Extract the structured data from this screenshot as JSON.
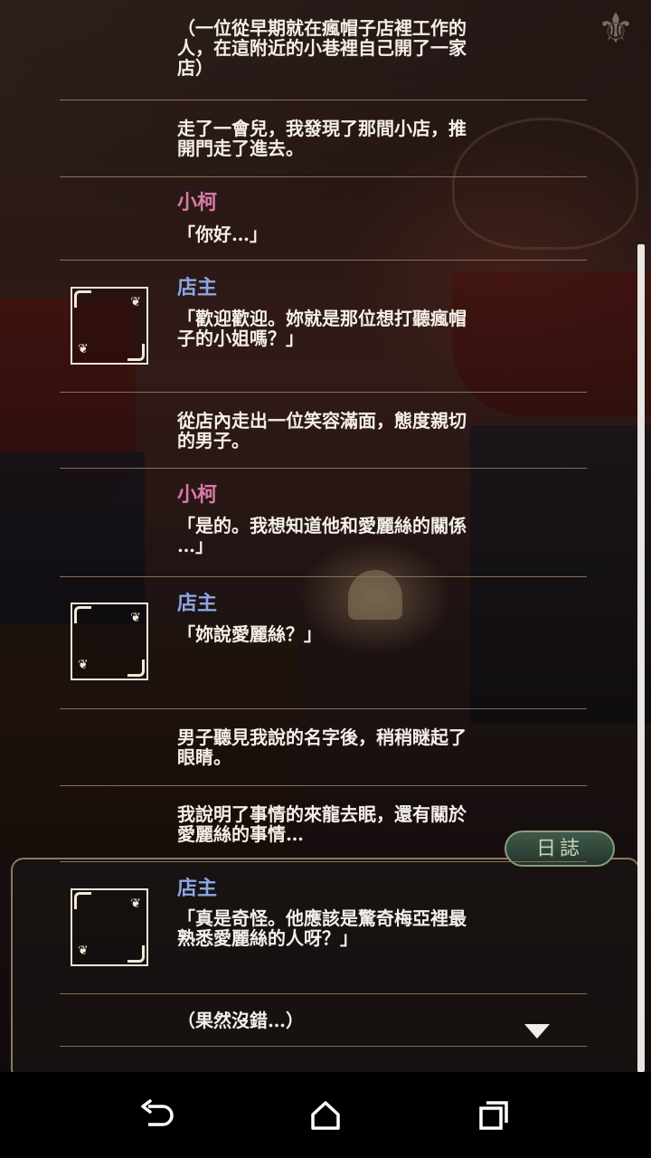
{
  "log_button_label": "日誌",
  "entries": [
    {
      "speaker": "",
      "text": "（一位從早期就在瘋帽子店裡工作的\n人，在這附近的小巷裡自己開了一家\n店）"
    },
    {
      "speaker": "",
      "text": "走了一會兒，我發現了那間小店，推\n開門走了進去。"
    },
    {
      "speaker": "小柯",
      "text": "「你好…」"
    },
    {
      "speaker": "店主",
      "text": "「歡迎歡迎。妳就是那位想打聽瘋帽\n子的小姐嗎？」"
    },
    {
      "speaker": "",
      "text": "從店內走出一位笑容滿面，態度親切\n的男子。"
    },
    {
      "speaker": "小柯",
      "text": "「是的。我想知道他和愛麗絲的關係\n…」"
    },
    {
      "speaker": "店主",
      "text": "「妳說愛麗絲？」"
    },
    {
      "speaker": "",
      "text": "男子聽見我說的名字後，稍稍瞇起了\n眼睛。"
    },
    {
      "speaker": "",
      "text": "我說明了事情的來龍去眠，還有關於\n愛麗絲的事情…"
    },
    {
      "speaker": "店主",
      "text": "「真是奇怪。他應該是驚奇梅亞裡最\n熟悉愛麗絲的人呀？」"
    },
    {
      "speaker": "",
      "text": "（果然沒錯…）"
    }
  ],
  "colors": {
    "speaker_player": "#d97aa8",
    "speaker_npc": "#8aa6e6",
    "text": "#f4efe9",
    "separator": "#8a6f55"
  },
  "icons": [
    "fleur-de-lis-icon",
    "scroll-down-arrow-icon",
    "back-icon",
    "home-icon",
    "recents-icon"
  ]
}
